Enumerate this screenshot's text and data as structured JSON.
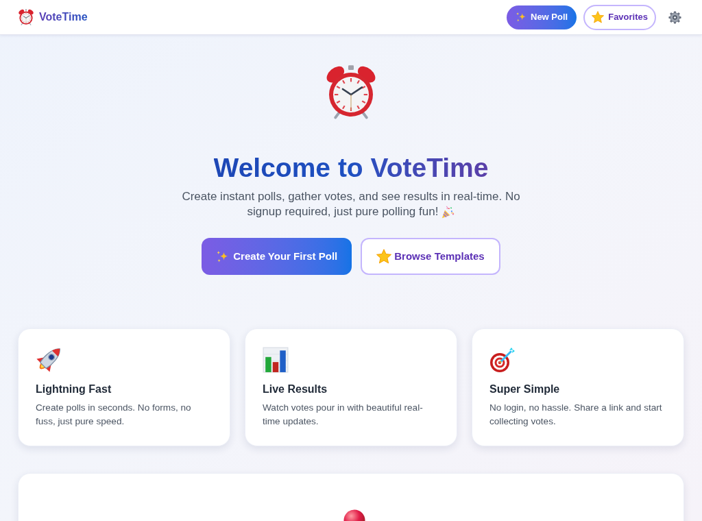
{
  "header": {
    "logo": "VoteTime",
    "buttons": [
      {
        "label": "New Poll",
        "kind": "primary"
      },
      {
        "label": "Favorites",
        "kind": "outline"
      }
    ]
  },
  "hero": {
    "title": "Welcome to VoteTime",
    "subtitle_lines": [
      "Create instant polls, gather votes, and see results in real-time. No",
      "signup required, just pure polling fun!"
    ],
    "buttons": [
      {
        "label": "Create Your First Poll",
        "kind": "primary"
      },
      {
        "label": "Browse Templates",
        "kind": "outline"
      }
    ]
  },
  "features": [
    {
      "title": "Lightning Fast",
      "description": "Create polls in seconds. No forms, no fuss, just pure speed."
    },
    {
      "title": "Live Results",
      "description": "Watch votes pour in with beautiful real-time updates."
    },
    {
      "title": "Super Simple",
      "description": "No login, no hassle. Share a link and start collecting votes."
    }
  ]
}
